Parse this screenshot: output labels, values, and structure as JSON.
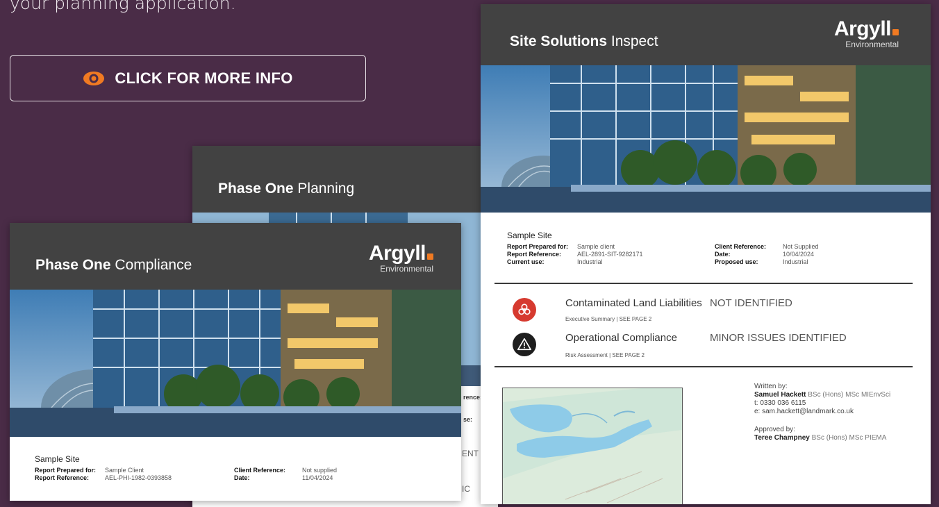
{
  "intro": {
    "text": "your planning application."
  },
  "cta": {
    "label": "CLICK FOR MORE INFO",
    "icon": "eye-icon",
    "icon_color": "#f07a22"
  },
  "colors": {
    "background": "#4a2c47",
    "header": "#424242",
    "accent": "#f07a22",
    "red_badge": "#d63a2f"
  },
  "logo": {
    "brand": "Argyll",
    "sub": "Environmental"
  },
  "reports": {
    "compliance": {
      "title_bold": "Phase One",
      "title_rest": "Compliance",
      "site": "Sample Site",
      "prepared_label": "Report Prepared for:",
      "prepared_value": "Sample Client",
      "reference_label": "Report Reference:",
      "reference_value": "AEL-PHI-1982-0393858",
      "client_ref_label": "Client Reference:",
      "client_ref_value": "Not supplied",
      "date_label": "Date:",
      "date_value": "11/04/2024"
    },
    "planning": {
      "title_bold": "Phase One",
      "title_rest": "Planning",
      "edge_text_1": "rence:",
      "edge_text_2": "se:",
      "edge_text_3": "ENT",
      "edge_text_4": "IC"
    },
    "inspect": {
      "title_bold": "Site Solutions",
      "title_rest": "Inspect",
      "site": "Sample Site",
      "prepared_label": "Report Prepared for:",
      "prepared_value": "Sample client",
      "reference_label": "Report Reference:",
      "reference_value": "AEL-2891-SIT-9282171",
      "current_use_label": "Current use:",
      "current_use_value": "Industrial",
      "client_ref_label": "Client Reference:",
      "client_ref_value": "Not Supplied",
      "date_label": "Date:",
      "date_value": "10/04/2024",
      "proposed_use_label": "Proposed use:",
      "proposed_use_value": "Industrial",
      "risks": [
        {
          "label": "Contaminated Land Liabilities",
          "sub": "Executive Summary | SEE PAGE 2",
          "status": "NOT IDENTIFIED",
          "icon": "biohazard-icon"
        },
        {
          "label": "Operational Compliance",
          "sub": "Risk Assessment | SEE PAGE 2",
          "status": "MINOR ISSUES IDENTIFIED",
          "icon": "warning-icon"
        }
      ],
      "written_label": "Written by:",
      "written_name": "Samuel Hackett",
      "written_creds": "BSc (Hons) MSc MIEnvSci",
      "phone": "t: 0330 036 6115",
      "email": "e: sam.hackett@landmark.co.uk",
      "approved_label": "Approved by:",
      "approved_name": "Teree Champney",
      "approved_creds": "BSc (Hons) MSc PIEMA"
    }
  }
}
